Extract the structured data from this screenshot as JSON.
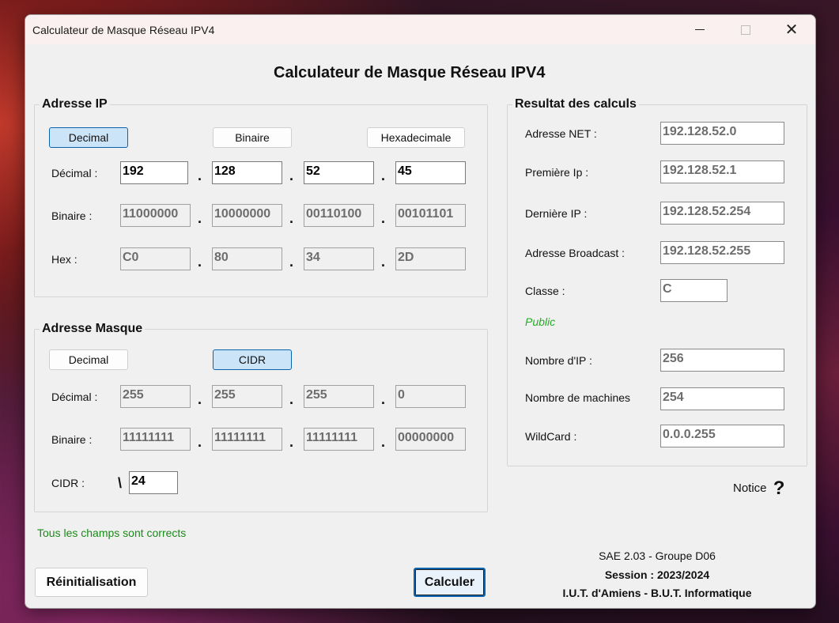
{
  "window": {
    "title": "Calculateur de Masque Réseau IPV4"
  },
  "heading": "Calculateur de Masque Réseau IPV4",
  "ip": {
    "group_label": "Adresse IP",
    "mode_buttons": [
      "Decimal",
      "Binaire",
      "Hexadecimale"
    ],
    "selected_mode": "Decimal",
    "rows": [
      {
        "label": "Décimal :",
        "values": [
          "192",
          "128",
          "52",
          "45"
        ]
      },
      {
        "label": "Binaire :",
        "values": [
          "11000000",
          "10000000",
          "00110100",
          "00101101"
        ]
      },
      {
        "label": "Hex :",
        "values": [
          "C0",
          "80",
          "34",
          "2D"
        ]
      }
    ]
  },
  "mask": {
    "group_label": "Adresse Masque",
    "mode_buttons": [
      "Decimal",
      "CIDR"
    ],
    "selected_mode": "CIDR",
    "rows": [
      {
        "label": "Décimal :",
        "values": [
          "255",
          "255",
          "255",
          "0"
        ]
      },
      {
        "label": "Binaire :",
        "values": [
          "11111111",
          "11111111",
          "11111111",
          "00000000"
        ]
      }
    ],
    "cidr_label": "CIDR :",
    "cidr_prefix": "\\",
    "cidr_value": "24"
  },
  "separator": ".",
  "results": {
    "group_label": "Resultat des calculs",
    "net_label": "Adresse NET :",
    "net_value": "192.128.52.0",
    "first_label": "Première Ip :",
    "first_value": "192.128.52.1",
    "last_label": "Dernière IP :",
    "last_value": "192.128.52.254",
    "broadcast_label": "Adresse Broadcast :",
    "broadcast_value": "192.128.52.255",
    "class_label": "Classe :",
    "class_value": "C",
    "type_text": "Public",
    "ipcount_label": "Nombre d'IP :",
    "ipcount_value": "256",
    "machines_label": "Nombre de machines",
    "machines_value": "254",
    "wildcard_label": "WildCard :",
    "wildcard_value": "0.0.0.255"
  },
  "notice": {
    "label": "Notice",
    "icon": "?"
  },
  "status": "Tous les champs sont corrects",
  "buttons": {
    "reset": "Réinitialisation",
    "calculate": "Calculer"
  },
  "footer": {
    "line1": "SAE 2.03 - Groupe D06",
    "line2": "Session : 2023/2024",
    "line3": "I.U.T. d'Amiens - B.U.T. Informatique"
  },
  "colors": {
    "selected_button": "#cce4f7",
    "status_green": "#1a8a1a",
    "public_green": "#2aa82a",
    "accent": "#0a64ad"
  }
}
